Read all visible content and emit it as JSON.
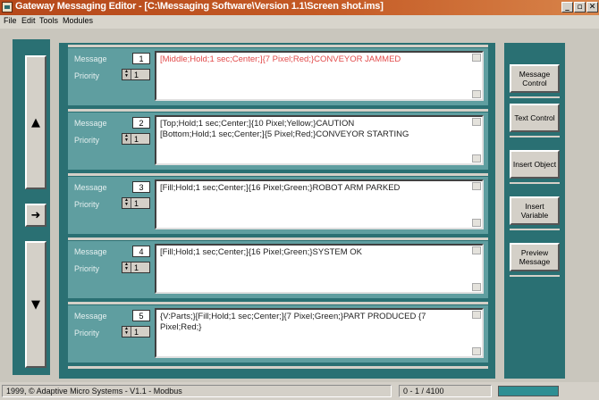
{
  "window": {
    "title": "Gateway Messaging Editor - [C:\\Messaging Software\\Version 1.1\\Screen shot.ims]",
    "buttons": {
      "minimize": "_",
      "maximize": "▫",
      "close": "✕"
    }
  },
  "menu": [
    "File",
    "Edit",
    "Tools",
    "Modules"
  ],
  "left_nav": {
    "up_icon": "▲",
    "go_icon": "➜",
    "down_icon": "▼"
  },
  "labels": {
    "message": "Message",
    "priority": "Priority"
  },
  "messages": [
    {
      "number": "1",
      "priority": "1",
      "lines": [
        "[Middle;Hold;1 sec;Center;]{7 Pixel;Red;}CONVEYOR JAMMED"
      ],
      "color": "#e24a4a"
    },
    {
      "number": "2",
      "priority": "1",
      "lines": [
        "[Top;Hold;1 sec;Center;]{10 Pixel;Yellow;}CAUTION",
        "[Bottom;Hold;1 sec;Center;]{5 Pixel;Red;}CONVEYOR STARTING"
      ],
      "color": "#222222"
    },
    {
      "number": "3",
      "priority": "1",
      "lines": [
        "[Fill;Hold;1 sec;Center;]{16 Pixel;Green;}ROBOT ARM PARKED"
      ],
      "color": "#222222"
    },
    {
      "number": "4",
      "priority": "1",
      "lines": [
        "[Fill;Hold;1 sec;Center;]{16 Pixel;Green;}SYSTEM OK"
      ],
      "color": "#222222"
    },
    {
      "number": "5",
      "priority": "1",
      "lines": [
        "{V:Parts;}[Fill;Hold;1 sec;Center;]{7 Pixel;Green;}PART PRODUCED {7",
        "Pixel;Red;}"
      ],
      "color": "#222222"
    }
  ],
  "side_buttons": [
    {
      "label": "Message Control"
    },
    {
      "label": "Text Control"
    },
    {
      "label": "Insert Object"
    },
    {
      "label": "Insert Variable"
    },
    {
      "label": "Preview Message"
    }
  ],
  "status": {
    "copyright": "1999, © Adaptive Micro Systems  -  V1.1 - Modbus",
    "position": "0   -     1  /  4100"
  },
  "colors": {
    "panel": "#2a7073",
    "row": "#5f9ea0",
    "title_bar": "#b5481a",
    "error_text": "#e24a4a"
  }
}
